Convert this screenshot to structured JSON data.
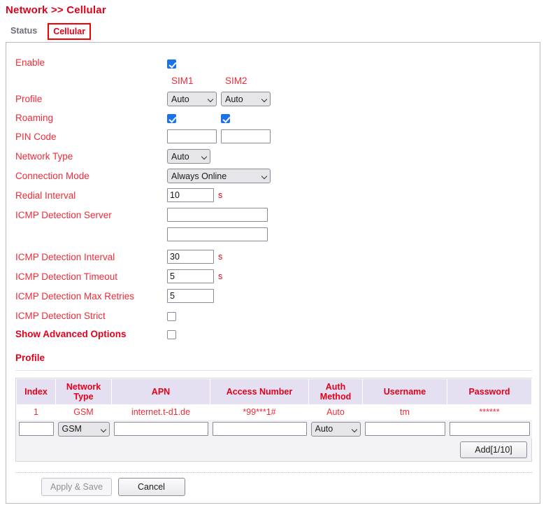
{
  "breadcrumb": "Network >> Cellular",
  "tabs": [
    {
      "label": "Status",
      "active": false
    },
    {
      "label": "Cellular",
      "active": true
    }
  ],
  "colors": {
    "accent_red": "#e3001b",
    "label_red": "#ef2b38",
    "tab_inactive": "#6e6e78",
    "checkbox_on": "#1a73e8",
    "table_header_bg": "#e4e0f2"
  },
  "sim_headers": {
    "sim1": "SIM1",
    "sim2": "SIM2"
  },
  "form": {
    "enable": {
      "label": "Enable",
      "checked": true
    },
    "profile": {
      "label": "Profile",
      "sim1_value": "Auto",
      "sim2_value": "Auto",
      "options": [
        "Auto"
      ]
    },
    "roaming": {
      "label": "Roaming",
      "sim1_checked": true,
      "sim2_checked": true
    },
    "pin_code": {
      "label": "PIN Code",
      "sim1_value": "",
      "sim2_value": ""
    },
    "network_type": {
      "label": "Network Type",
      "value": "Auto",
      "options": [
        "Auto"
      ]
    },
    "connection_mode": {
      "label": "Connection Mode",
      "value": "Always Online",
      "options": [
        "Always Online"
      ]
    },
    "redial_interval": {
      "label": "Redial Interval",
      "value": "10",
      "unit": "s"
    },
    "icmp_detection_server": {
      "label": "ICMP Detection Server",
      "value1": "",
      "value2": ""
    },
    "icmp_detection_interval": {
      "label": "ICMP Detection Interval",
      "value": "30",
      "unit": "s"
    },
    "icmp_detection_timeout": {
      "label": "ICMP Detection Timeout",
      "value": "5",
      "unit": "s"
    },
    "icmp_detection_max_retries": {
      "label": "ICMP Detection Max Retries",
      "value": "5"
    },
    "icmp_detection_strict": {
      "label": "ICMP Detection Strict",
      "checked": false
    },
    "show_advanced_options": {
      "label": "Show Advanced Options",
      "checked": false
    }
  },
  "profile_section": {
    "title": "Profile",
    "columns": [
      "Index",
      "Network Type",
      "APN",
      "Access Number",
      "Auth Method",
      "Username",
      "Password"
    ],
    "rows": [
      {
        "index": "1",
        "network_type": "GSM",
        "apn": "internet.t-d1.de",
        "access_number": "*99***1#",
        "auth_method": "Auto",
        "username": "tm",
        "password": "******"
      }
    ],
    "new_row": {
      "index": "",
      "network_type": "GSM",
      "network_type_options": [
        "GSM"
      ],
      "apn": "",
      "access_number": "",
      "auth_method": "Auto",
      "auth_method_options": [
        "Auto"
      ],
      "username": "",
      "password": ""
    },
    "add_button": "Add[1/10]"
  },
  "footer": {
    "apply_label": "Apply & Save",
    "apply_disabled": true,
    "cancel_label": "Cancel"
  }
}
